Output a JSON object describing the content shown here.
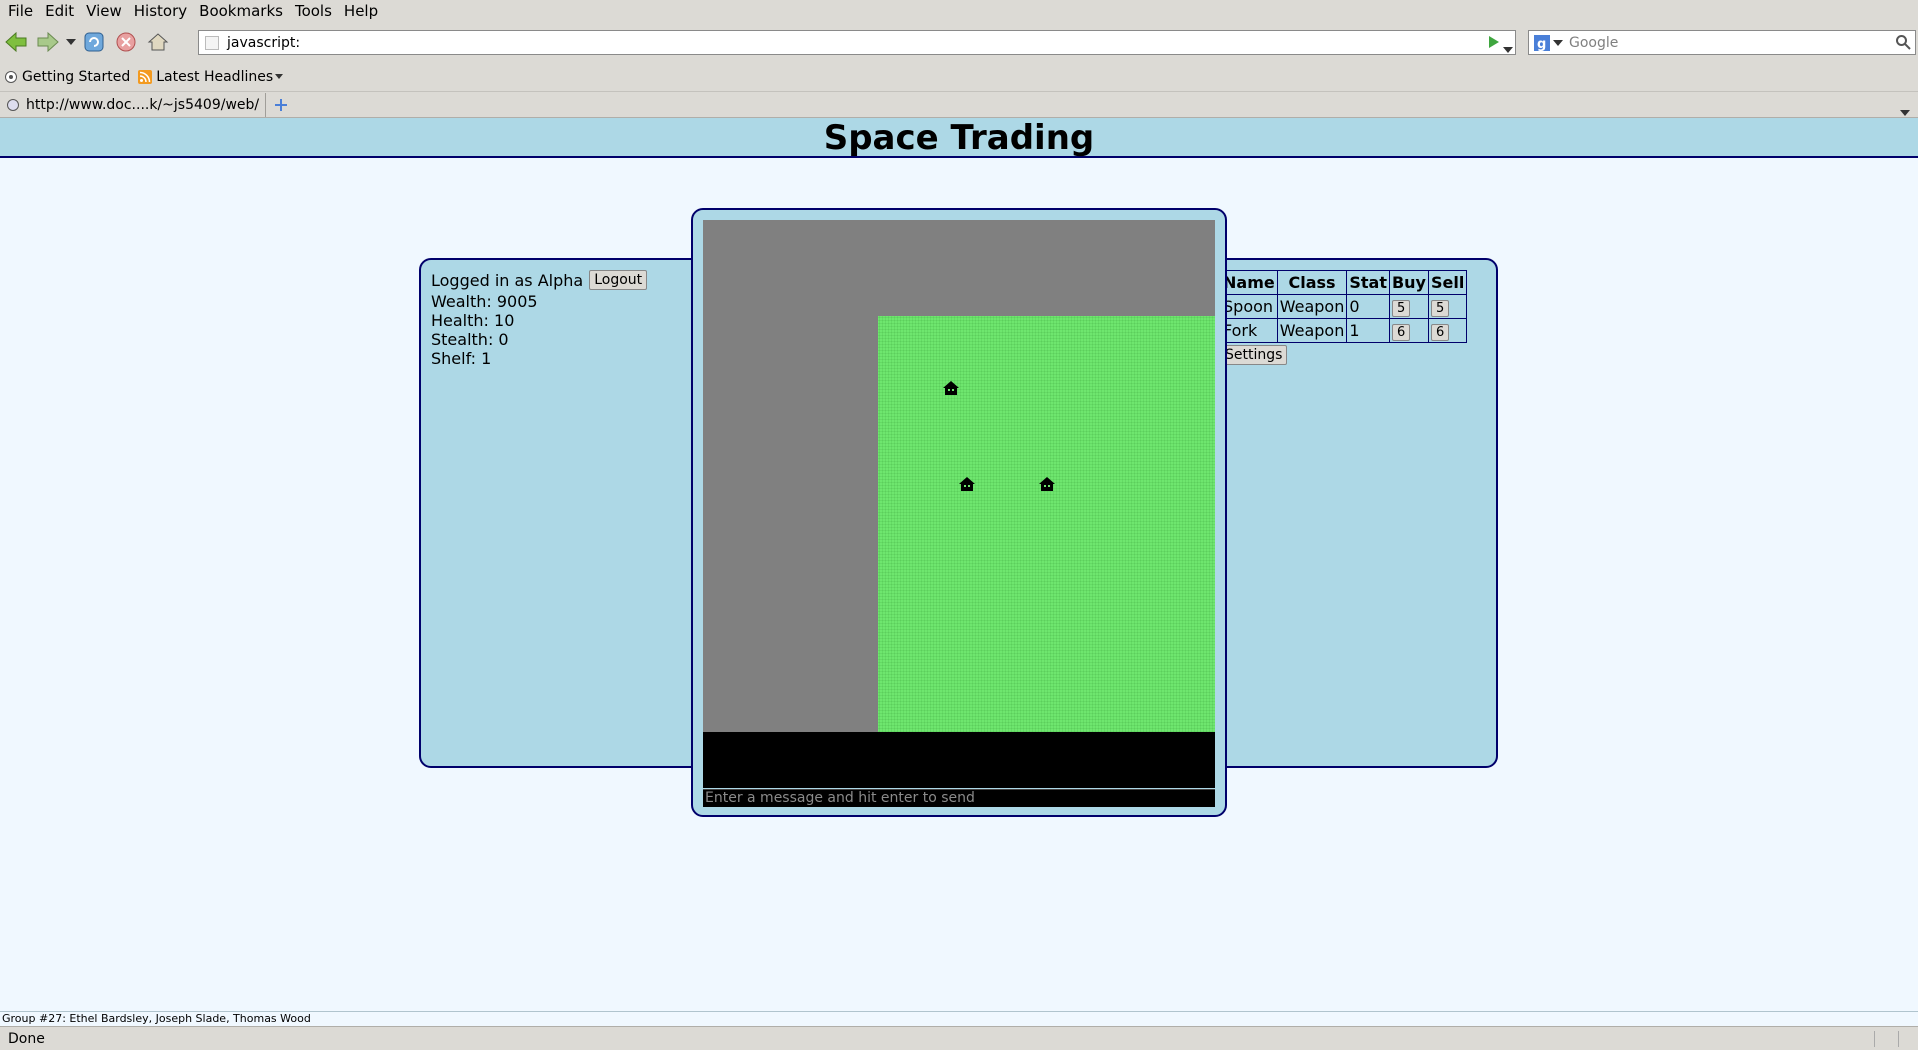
{
  "menu": {
    "items": [
      "File",
      "Edit",
      "View",
      "History",
      "Bookmarks",
      "Tools",
      "Help"
    ]
  },
  "navbar": {
    "url": "javascript:",
    "search_placeholder": "Google"
  },
  "bookmarks": {
    "items": [
      "Getting Started",
      "Latest Headlines"
    ]
  },
  "tab": {
    "label": "http://www.doc....k/~js5409/web/"
  },
  "page": {
    "title": "Space Trading"
  },
  "player": {
    "logged_in": "Logged in as Alpha",
    "logout_label": "Logout",
    "wealth": "Wealth: 9005",
    "health": "Health: 10",
    "stealth": "Stealth: 0",
    "shelf": "Shelf: 1"
  },
  "chat": {
    "placeholder": "Enter a message and hit enter to send"
  },
  "shop": {
    "headers": [
      "Name",
      "Class",
      "Stat",
      "Buy",
      "Sell"
    ],
    "rows": [
      {
        "name": "Spoon",
        "class": "Weapon",
        "stat": "0",
        "buy": "5",
        "sell": "5"
      },
      {
        "name": "Fork",
        "class": "Weapon",
        "stat": "1",
        "buy": "6",
        "sell": "6"
      }
    ],
    "settings_label": "Settings"
  },
  "footer": {
    "note": "Group #27: Ethel Bardsley, Joseph Slade, Thomas Wood"
  },
  "status": {
    "text": "Done"
  },
  "colors": {
    "page_bg": "#f0f8ff",
    "panel_bg": "#add8e6",
    "border": "#00006b",
    "grass": "#6ee66e",
    "map_bg": "#808080"
  }
}
